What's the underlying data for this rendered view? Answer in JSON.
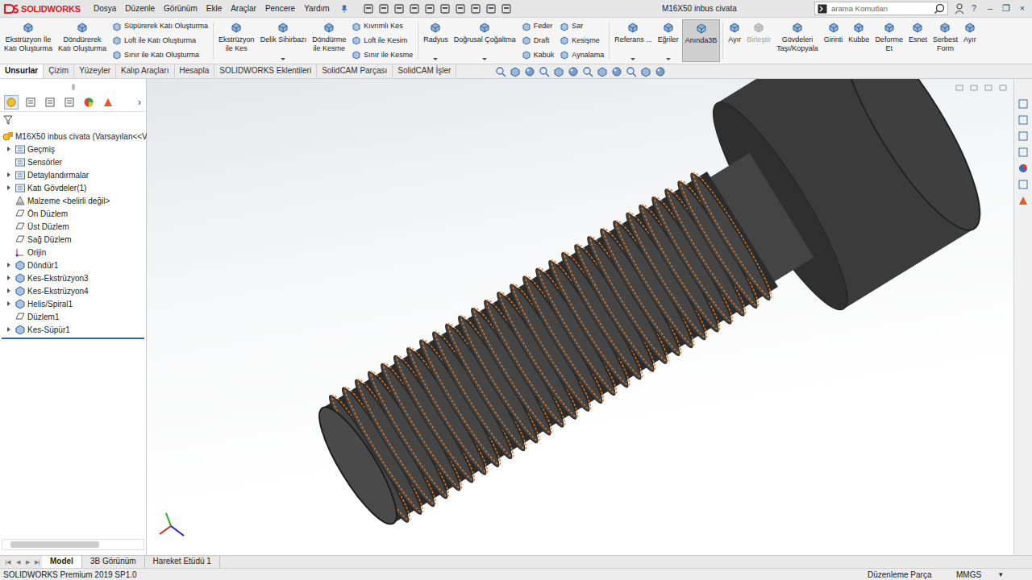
{
  "window": {
    "title": "M16X50 inbus civata",
    "logo": "SOLIDWORKS"
  },
  "menus": [
    "Dosya",
    "Düzenle",
    "Görünüm",
    "Ekle",
    "Araçlar",
    "Pencere",
    "Yardım"
  ],
  "search": {
    "placeholder": "arama Komutları"
  },
  "window_controls": [
    "?",
    "–",
    "❐",
    "×"
  ],
  "command_groups": [
    {
      "items": [
        {
          "kind": "big",
          "lines": [
            "Ekstrüzyon İle",
            "Katı Oluşturma"
          ],
          "selected": false,
          "disabled": false,
          "dropdown": false
        },
        {
          "kind": "big",
          "lines": [
            "Döndürerek",
            "Katı Oluşturma"
          ],
          "selected": false,
          "disabled": false,
          "dropdown": false
        },
        {
          "kind": "stack",
          "rows": [
            "Süpürerek Katı Oluşturma",
            "Loft ile Katı Oluşturma",
            "Sınır ile Katı Oluşturma"
          ]
        }
      ]
    },
    {
      "items": [
        {
          "kind": "big",
          "lines": [
            "Ekstrüzyon",
            "ile Kes"
          ],
          "selected": false,
          "disabled": false,
          "dropdown": false
        },
        {
          "kind": "big",
          "lines": [
            "Delik Sihirbazı"
          ],
          "selected": false,
          "disabled": false,
          "dropdown": true
        },
        {
          "kind": "big",
          "lines": [
            "Döndürme",
            "ile Kesme"
          ],
          "selected": false,
          "disabled": false,
          "dropdown": false
        },
        {
          "kind": "stack",
          "rows": [
            "Kıvrımlı Kes",
            "Loft ile Kesim",
            "Sınır ile Kesme"
          ]
        }
      ]
    },
    {
      "items": [
        {
          "kind": "big",
          "lines": [
            "Radyus"
          ],
          "selected": false,
          "disabled": false,
          "dropdown": true
        },
        {
          "kind": "big",
          "lines": [
            "Doğrusal Çoğaltma"
          ],
          "selected": false,
          "disabled": false,
          "dropdown": true
        },
        {
          "kind": "stack",
          "rows": [
            "Feder",
            "Draft",
            "Kabuk"
          ]
        },
        {
          "kind": "stack",
          "rows": [
            "Sar",
            "Kesişme",
            "Aynalama"
          ]
        }
      ]
    },
    {
      "items": [
        {
          "kind": "big",
          "lines": [
            "Referans ..."
          ],
          "selected": false,
          "disabled": false,
          "dropdown": true
        },
        {
          "kind": "big",
          "lines": [
            "Eğriler"
          ],
          "selected": false,
          "disabled": false,
          "dropdown": true
        },
        {
          "kind": "big",
          "lines": [
            "Anında3B"
          ],
          "selected": true,
          "disabled": false,
          "dropdown": false
        }
      ]
    },
    {
      "items": [
        {
          "kind": "big",
          "lines": [
            "Ayır"
          ],
          "selected": false,
          "disabled": false,
          "dropdown": false
        },
        {
          "kind": "big",
          "lines": [
            "Birleştir"
          ],
          "selected": false,
          "disabled": true,
          "dropdown": false
        },
        {
          "kind": "big",
          "lines": [
            "Gövdeleri",
            "Taşı/Kopyala"
          ],
          "selected": false,
          "disabled": false,
          "dropdown": false
        },
        {
          "kind": "big",
          "lines": [
            "Girinti"
          ],
          "selected": false,
          "disabled": false,
          "dropdown": false
        },
        {
          "kind": "big",
          "lines": [
            "Kubbe"
          ],
          "selected": false,
          "disabled": false,
          "dropdown": false
        },
        {
          "kind": "big",
          "lines": [
            "Deforme",
            "Et"
          ],
          "selected": false,
          "disabled": false,
          "dropdown": false
        },
        {
          "kind": "big",
          "lines": [
            "Esnet"
          ],
          "selected": false,
          "disabled": false,
          "dropdown": false
        },
        {
          "kind": "big",
          "lines": [
            "Serbest",
            "Form"
          ],
          "selected": false,
          "disabled": false,
          "dropdown": false
        },
        {
          "kind": "big",
          "lines": [
            "Ayır"
          ],
          "selected": false,
          "disabled": false,
          "dropdown": false
        }
      ]
    }
  ],
  "tabs": [
    {
      "label": "Unsurlar",
      "selected": true
    },
    {
      "label": "Çizim",
      "selected": false
    },
    {
      "label": "Yüzeyler",
      "selected": false
    },
    {
      "label": "Kalıp Araçları",
      "selected": false
    },
    {
      "label": "Hesapla",
      "selected": false
    },
    {
      "label": "SOLIDWORKS Eklentileri",
      "selected": false
    },
    {
      "label": "SolidCAM Parçası",
      "selected": false
    },
    {
      "label": "SolidCAM İşler",
      "selected": false
    }
  ],
  "panel_more": "›",
  "tree": [
    {
      "label": "M16X50 inbus civata  (Varsayılan<<V",
      "kind": "root",
      "expandable": false
    },
    {
      "label": "Geçmiş",
      "kind": "folder",
      "expandable": true
    },
    {
      "label": "Sensörler",
      "kind": "folder",
      "expandable": false
    },
    {
      "label": "Detaylandırmalar",
      "kind": "folder",
      "expandable": true
    },
    {
      "label": "Katı Gövdeler(1)",
      "kind": "folder",
      "expandable": true
    },
    {
      "label": "Malzeme <belirli değil>",
      "kind": "material",
      "expandable": false
    },
    {
      "label": "Ön Düzlem",
      "kind": "plane",
      "expandable": false
    },
    {
      "label": "Üst Düzlem",
      "kind": "plane",
      "expandable": false
    },
    {
      "label": "Sağ Düzlem",
      "kind": "plane",
      "expandable": false
    },
    {
      "label": "Orijin",
      "kind": "origin",
      "expandable": false
    },
    {
      "label": "Döndür1",
      "kind": "feature",
      "expandable": true
    },
    {
      "label": "Kes-Ekstrüzyon3",
      "kind": "feature",
      "expandable": true
    },
    {
      "label": "Kes-Ekstrüzyon4",
      "kind": "feature",
      "expandable": true
    },
    {
      "label": "Helis/Spiral1",
      "kind": "feature",
      "expandable": true
    },
    {
      "label": "Düzlem1",
      "kind": "plane",
      "expandable": false
    },
    {
      "label": "Kes-Süpür1",
      "kind": "feature",
      "expandable": true
    }
  ],
  "bottom_nav": [
    "|◀",
    "◀",
    "▶",
    "▶|"
  ],
  "bottom_tabs": [
    {
      "label": "Model",
      "selected": true
    },
    {
      "label": "3B Görünüm",
      "selected": false
    },
    {
      "label": "Hareket Etüdü 1",
      "selected": false
    }
  ],
  "status_bar": {
    "product": "SOLIDWORKS Premium 2019 SP1.0",
    "mode": "Düzenleme Parça",
    "units": "MMGS",
    "units_arrow": "▾"
  }
}
